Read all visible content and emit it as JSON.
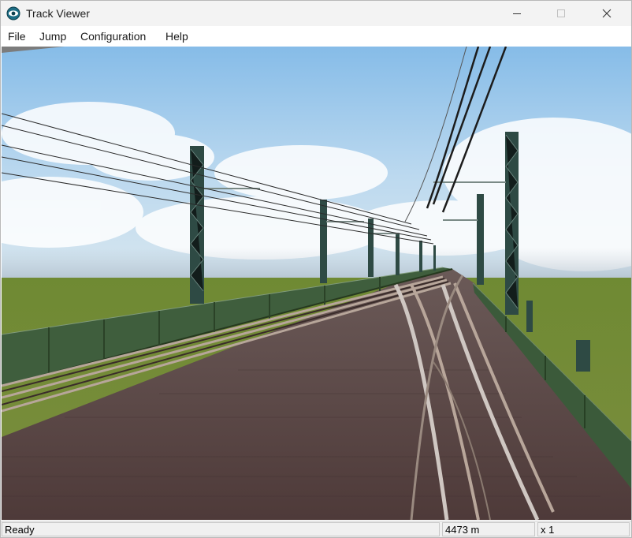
{
  "window": {
    "title": "Track Viewer",
    "app_icon": "camera-eye-icon"
  },
  "titlebar_buttons": [
    {
      "name": "minimize-button",
      "icon": "minimize-icon"
    },
    {
      "name": "maximize-button",
      "icon": "maximize-icon"
    },
    {
      "name": "close-button",
      "icon": "close-icon"
    }
  ],
  "menu": {
    "items": [
      {
        "label": "File"
      },
      {
        "label": "Jump"
      },
      {
        "label": "Configuration"
      },
      {
        "label": "Help"
      }
    ]
  },
  "status": {
    "message": "Ready",
    "distance": "4473 m",
    "speed": "x 1"
  },
  "colors": {
    "sky_top": "#7fb6e6",
    "sky_bottom": "#cfe4f2",
    "grass": "#7a8a3a",
    "bridge_girder": "#3e5d3c",
    "track_bed": "#5e4a48",
    "rail": "#b8a79a",
    "mast": "#2f4a45"
  }
}
